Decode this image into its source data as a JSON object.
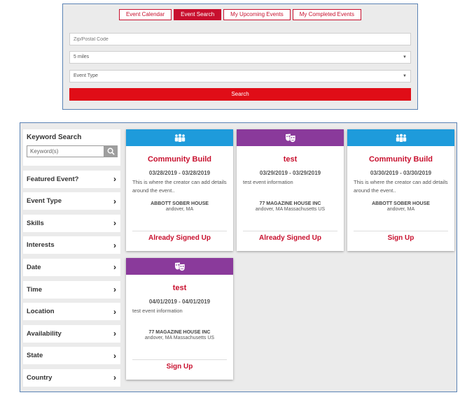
{
  "tabs": [
    {
      "label": "Event Calendar"
    },
    {
      "label": "Event Search"
    },
    {
      "label": "My Upcoming Events"
    },
    {
      "label": "My Completed Events"
    }
  ],
  "search": {
    "zip_placeholder": "Zip/Postal Code",
    "distance_value": "5 miles",
    "event_type_value": "Event Type",
    "button_label": "Search"
  },
  "sidebar": {
    "keyword_title": "Keyword Search",
    "keyword_placeholder": "Keyword(s)",
    "filters": [
      {
        "label": "Featured Event?"
      },
      {
        "label": "Event Type"
      },
      {
        "label": "Skills"
      },
      {
        "label": "Interests"
      },
      {
        "label": "Date"
      },
      {
        "label": "Time"
      },
      {
        "label": "Location"
      },
      {
        "label": "Availability"
      },
      {
        "label": "State"
      },
      {
        "label": "Country"
      }
    ]
  },
  "colors": {
    "accent_red": "#c8102e",
    "search_red": "#e00d17",
    "header_blue": "#1e9bdb",
    "header_purple": "#8a3a9b"
  },
  "cards": [
    {
      "icon": "group-icon",
      "header_color": "#1e9bdb",
      "title": "Community Build",
      "date": "03/28/2019 - 03/28/2019",
      "description": "This is where the creator can add details around the event..",
      "venue": "ABBOTT SOBER HOUSE",
      "address": "andover, MA",
      "action": "Already Signed Up"
    },
    {
      "icon": "theater-masks-icon",
      "header_color": "#8a3a9b",
      "title": "test",
      "date": "03/29/2019 - 03/29/2019",
      "description": "test event information",
      "venue": "77 MAGAZINE HOUSE INC",
      "address": "andover, MA Massachusetts US",
      "action": "Already Signed Up"
    },
    {
      "icon": "group-icon",
      "header_color": "#1e9bdb",
      "title": "Community Build",
      "date": "03/30/2019 - 03/30/2019",
      "description": "This is where the creator can add details around the event..",
      "venue": "ABBOTT SOBER HOUSE",
      "address": "andover, MA",
      "action": "Sign Up"
    },
    {
      "icon": "theater-masks-icon",
      "header_color": "#8a3a9b",
      "title": "test",
      "date": "04/01/2019 - 04/01/2019",
      "description": "test event information",
      "venue": "77 MAGAZINE HOUSE INC",
      "address": "andover, MA Massachusetts US",
      "action": "Sign Up"
    }
  ]
}
